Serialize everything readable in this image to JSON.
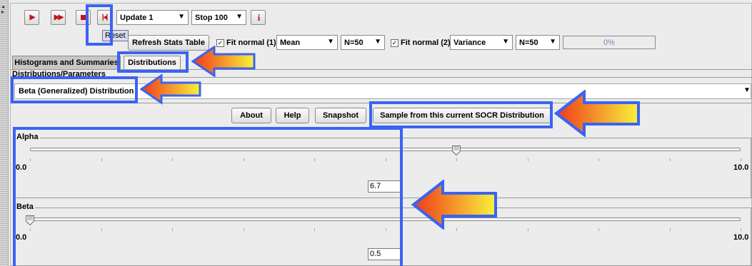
{
  "toolbar": {
    "play_icon": "play-icon",
    "fast_forward_icon": "fast-forward-icon",
    "stop_icon": "stop-icon",
    "reset_icon": "reset-icon",
    "update_label": "Update 1",
    "stop_label": "Stop 100",
    "info_label": "i",
    "reset_tooltip": "Reset",
    "refresh_label": "Refresh Stats Table",
    "fit_normal_1_label": "Fit normal (1)",
    "fit_normal_1_checked": true,
    "stat1_value": "Mean",
    "n1_value": "N=50",
    "fit_normal_2_label": "Fit normal (2)",
    "fit_normal_2_checked": true,
    "stat2_value": "Variance",
    "n2_value": "N=50",
    "progress_text": "0%",
    "progress": 0
  },
  "tabs": [
    {
      "label": "Histograms and Summaries",
      "active": false
    },
    {
      "label": "Distributions",
      "active": true
    }
  ],
  "panel": {
    "title": "Distributions/Parameters",
    "distribution": "Beta (Generalized) Distribution"
  },
  "buttons": {
    "about": "About",
    "help": "Help",
    "snapshot": "Snapshot",
    "sample": "Sample from this current SOCR Distribution"
  },
  "sliders": [
    {
      "title": "Alpha",
      "min_label": "0.0",
      "max_label": "10.0",
      "min": 0,
      "max": 10,
      "value": 6,
      "field": "6.7"
    },
    {
      "title": "Beta",
      "min_label": "0.0",
      "max_label": "10.0",
      "min": 0,
      "max": 10,
      "value": 0,
      "field": "0.5"
    }
  ],
  "colors": {
    "highlight": "#3a63f3",
    "arrow_start": "#f03a1a",
    "arrow_end": "#f8f23a",
    "button_red": "#c0141b"
  }
}
